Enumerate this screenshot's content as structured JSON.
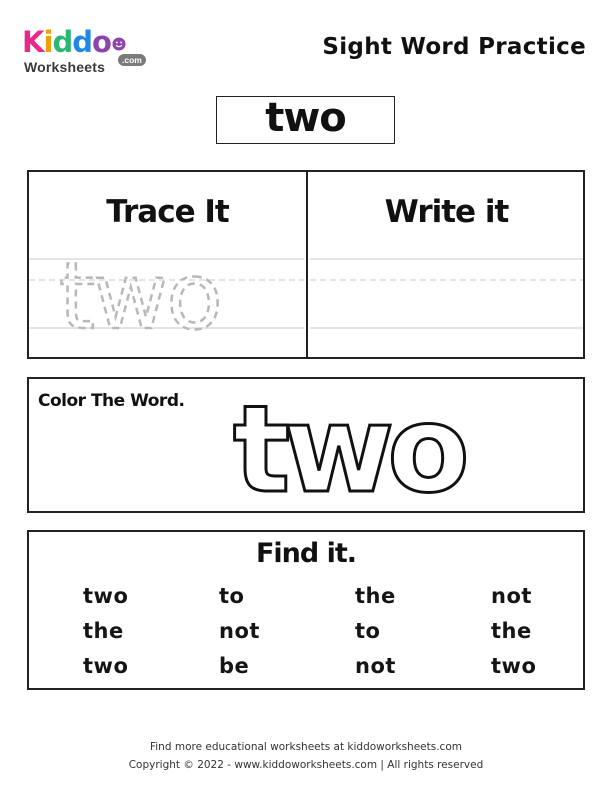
{
  "logo": {
    "letters": [
      {
        "ch": "K",
        "color": "#e7298a"
      },
      {
        "ch": "i",
        "color": "#f29f05"
      },
      {
        "ch": "d",
        "color": "#2bb673"
      },
      {
        "ch": "d",
        "color": "#1e88e5"
      },
      {
        "ch": "o",
        "color": "#8e44ad"
      }
    ],
    "sub": "Worksheets",
    "com": ".com"
  },
  "page_title": "Sight Word Practice",
  "sight_word": "two",
  "trace_section": {
    "trace_heading": "Trace It",
    "write_heading": "Write it",
    "trace_word": "two"
  },
  "color_section": {
    "label": "Color The Word.",
    "word": "two"
  },
  "find_section": {
    "title": "Find it.",
    "rows": [
      [
        "two",
        "to",
        "the",
        "not"
      ],
      [
        "the",
        "not",
        "to",
        "the"
      ],
      [
        "two",
        "be",
        "not",
        "two"
      ]
    ]
  },
  "footer": {
    "line1": "Find more educational worksheets at kiddoworksheets.com",
    "line2": "Copyright © 2022 - www.kiddoworksheets.com  |  All rights reserved"
  }
}
